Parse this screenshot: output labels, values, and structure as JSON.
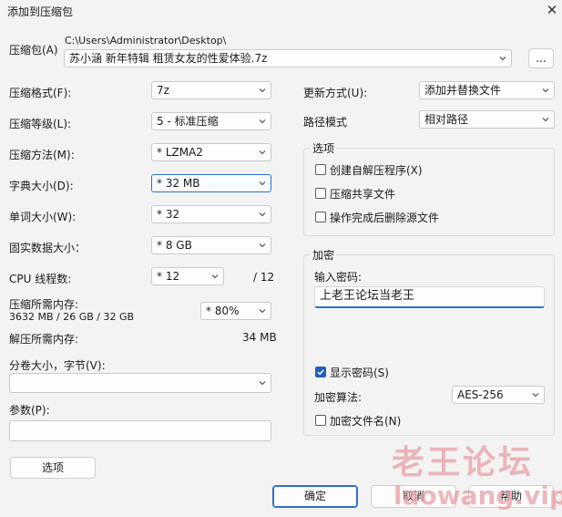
{
  "window": {
    "title": "添加到压缩包",
    "close_glyph": "✕"
  },
  "archive": {
    "label": "压缩包(A)",
    "path": "C:\\Users\\Administrator\\Desktop\\",
    "name": "苏小涵 新年特辑 租赁女友的性爱体验.7z",
    "browse_label": "..."
  },
  "left": {
    "format": {
      "label": "压缩格式(F):",
      "value": "7z"
    },
    "level": {
      "label": "压缩等级(L):",
      "value": "5 - 标准压缩"
    },
    "method": {
      "label": "压缩方法(M):",
      "value": "*  LZMA2"
    },
    "dict": {
      "label": "字典大小(D):",
      "value": "*  32 MB"
    },
    "word": {
      "label": "单词大小(W):",
      "value": "*  32"
    },
    "solid": {
      "label": "固实数据大小：",
      "value": "*  8 GB"
    },
    "cpu": {
      "label": "CPU 线程数:",
      "value": "*  12",
      "total": "/ 12"
    },
    "mem": {
      "label": "压缩所需内存:",
      "detail": "3632 MB / 26 GB / 32 GB",
      "value": "*  80%"
    },
    "decomp": {
      "label": "解压所需内存:",
      "value": "34 MB"
    },
    "split": {
      "label": "分卷大小，字节(V):",
      "value": ""
    },
    "params": {
      "label": "参数(P):",
      "value": ""
    },
    "options_button": "选项"
  },
  "right": {
    "update": {
      "label": "更新方式(U):",
      "value": "添加并替换文件"
    },
    "pathmode": {
      "label": "路径模式",
      "value": "相对路径"
    },
    "options": {
      "title": "选项",
      "sfx": {
        "label": "创建自解压程序(X)",
        "checked": false
      },
      "shared": {
        "label": "压缩共享文件",
        "checked": false
      },
      "delete": {
        "label": "操作完成后删除源文件",
        "checked": false
      }
    },
    "encryption": {
      "title": "加密",
      "pwd_label": "输入密码:",
      "password": "上老王论坛当老王",
      "show": {
        "label": "显示密码(S)",
        "checked": true
      },
      "method_label": "加密算法:",
      "method_value": "AES-256",
      "encnames": {
        "label": "加密文件名(N)",
        "checked": false
      }
    }
  },
  "buttons": {
    "ok": "确定",
    "cancel": "取消",
    "help": "帮助"
  },
  "watermark": {
    "title": "老王论坛",
    "url": "laowang.vip"
  },
  "colors": {
    "accent": "#2f6fce",
    "watermark": "#e8a0a8"
  }
}
